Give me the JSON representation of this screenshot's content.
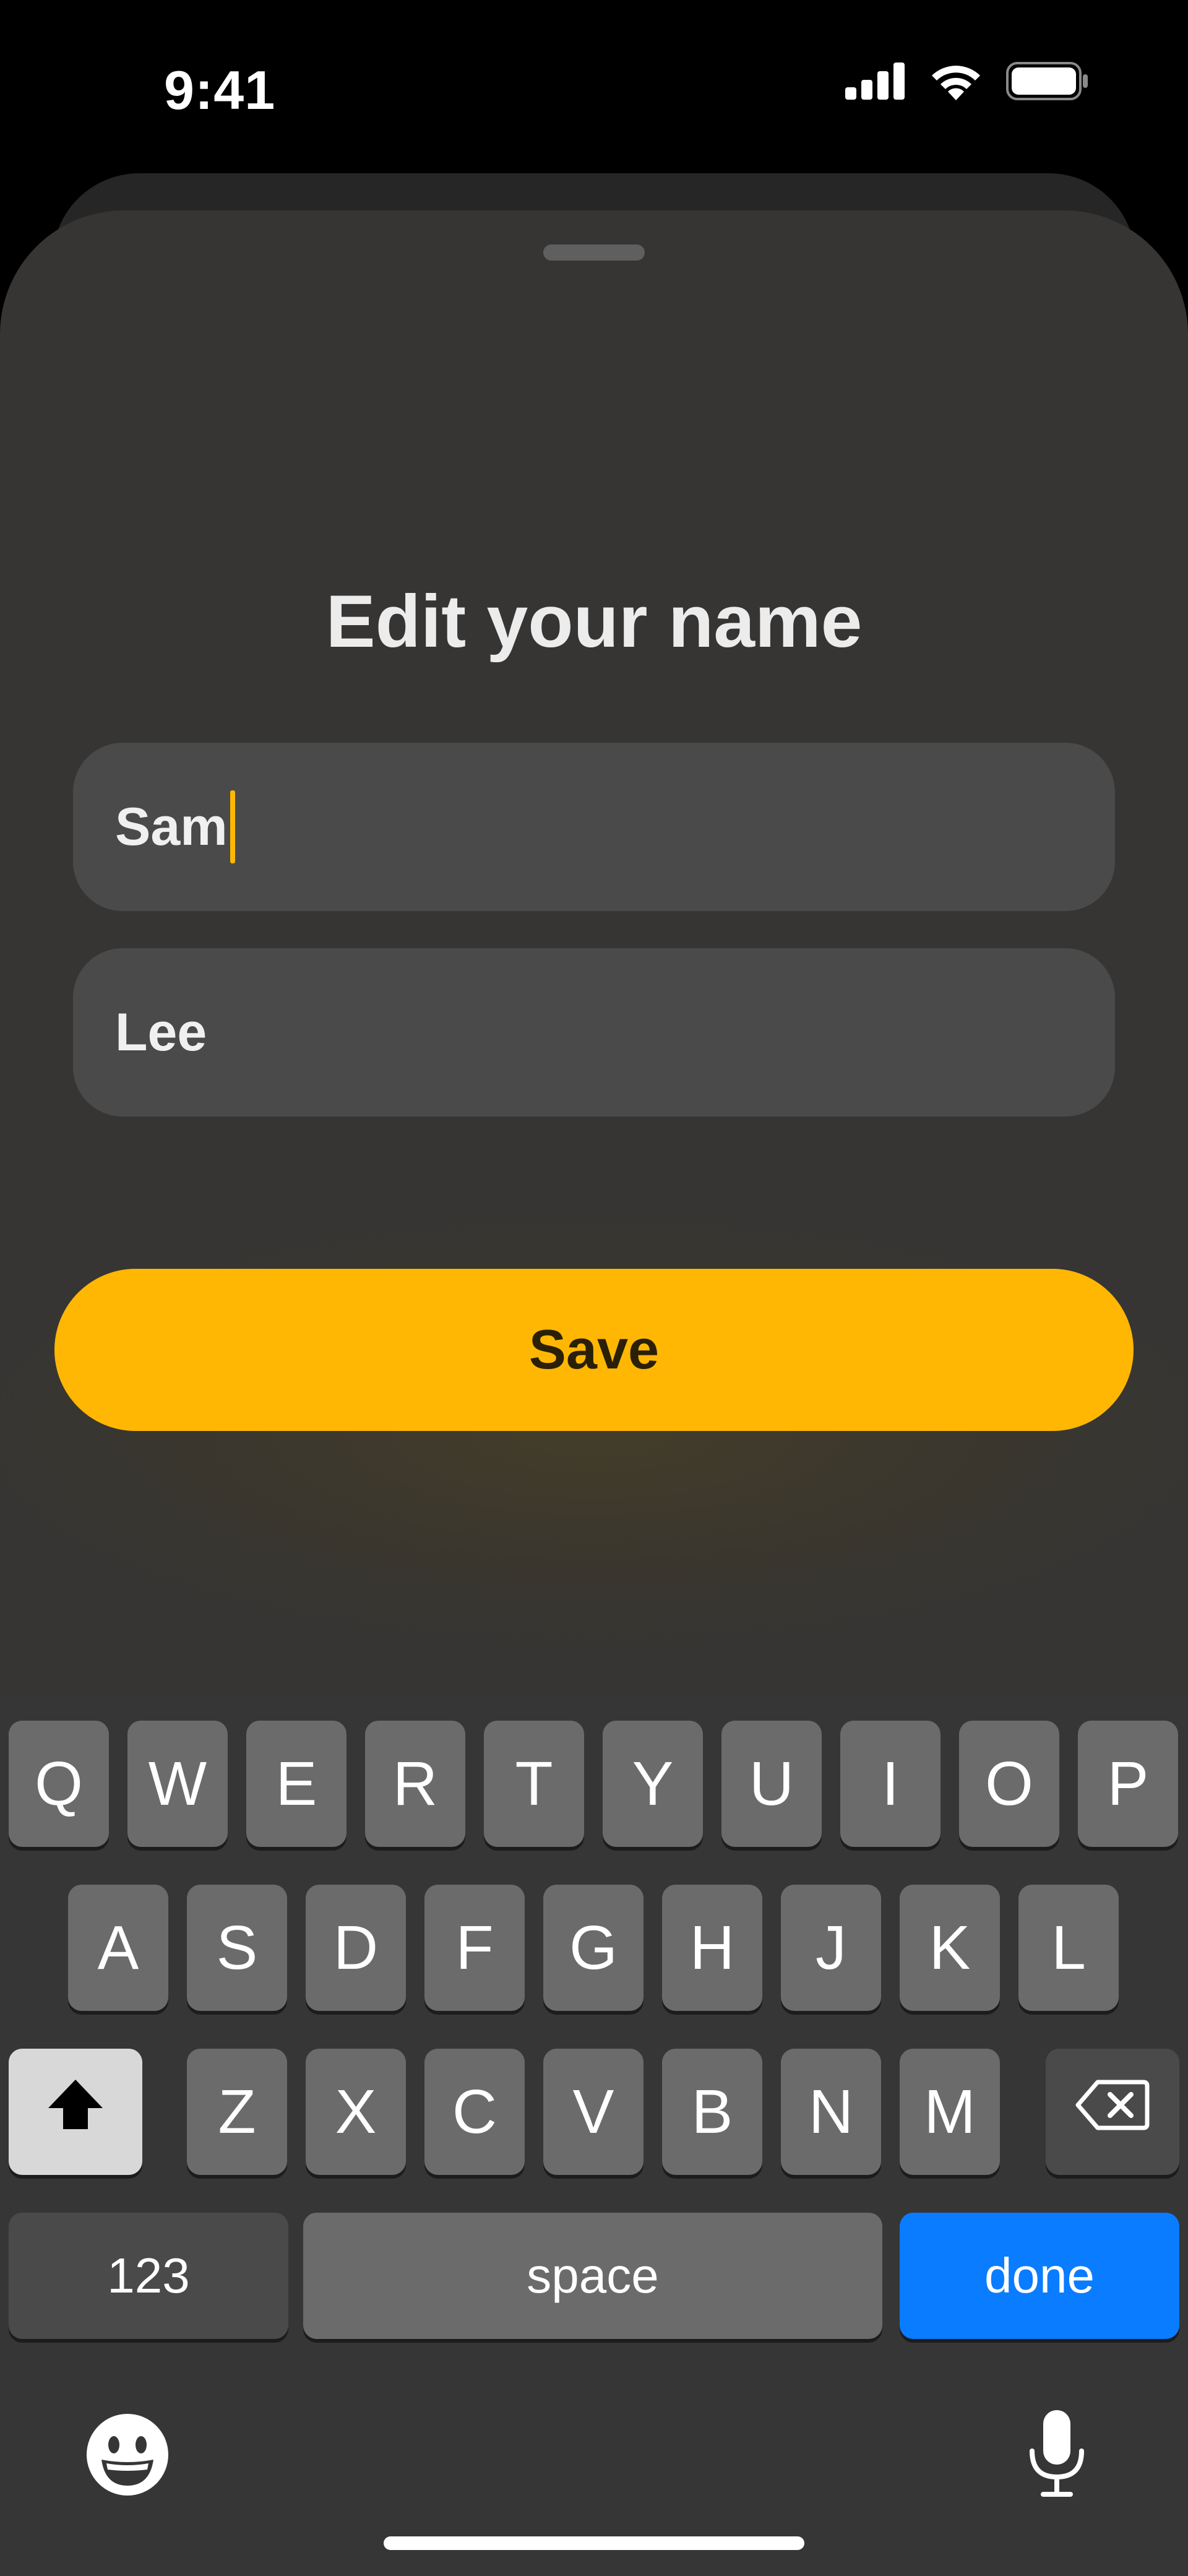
{
  "status_bar": {
    "time": "9:41",
    "icons": [
      "cellular-signal-icon",
      "wifi-icon",
      "battery-icon"
    ]
  },
  "sheet": {
    "title": "Edit your name",
    "first_name": {
      "value": "Sam"
    },
    "last_name": {
      "value": "Lee"
    },
    "save_label": "Save"
  },
  "keyboard": {
    "row1": [
      "Q",
      "W",
      "E",
      "R",
      "T",
      "Y",
      "U",
      "I",
      "O",
      "P"
    ],
    "row2": [
      "A",
      "S",
      "D",
      "F",
      "G",
      "H",
      "J",
      "K",
      "L"
    ],
    "row3": [
      "Z",
      "X",
      "C",
      "V",
      "B",
      "N",
      "M"
    ],
    "numbers_label": "123",
    "space_label": "space",
    "done_label": "done",
    "icons": {
      "shift": "shift-icon",
      "delete": "delete-icon",
      "emoji": "emoji-icon",
      "mic": "microphone-icon"
    }
  },
  "colors": {
    "accent": "#ffb703",
    "done_key": "#0a7cff",
    "sheet_bg": "#363534",
    "field_bg": "#4a4a4a"
  }
}
